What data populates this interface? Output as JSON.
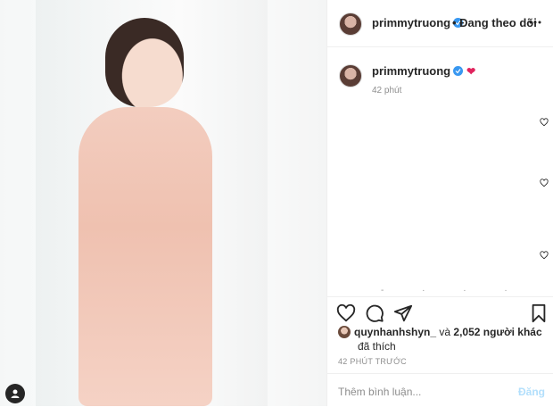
{
  "post": {
    "username": "primmytruong",
    "follow_status": "Đang theo dõi",
    "caption_username": "primmytruong",
    "caption_emoji": "❤",
    "caption_age": "42 phút",
    "likes_user": "quynhanhshyn_",
    "likes_joiner": "và",
    "likes_count_text": "2,052 người khác",
    "likes_suffix": "đã thích",
    "timestamp": "42 PHÚT TRƯỚC",
    "comment_placeholder": "Thêm bình luận...",
    "post_button": "Đăng",
    "dots": "- · · ·"
  },
  "colors": {
    "verified": "#3897f0",
    "heart": "#e0245e",
    "post_button_disabled": "#b2dffc"
  },
  "icons": [
    "user-icon",
    "verified-icon",
    "more-icon",
    "heart-icon",
    "comment-icon",
    "share-icon",
    "bookmark-icon"
  ]
}
